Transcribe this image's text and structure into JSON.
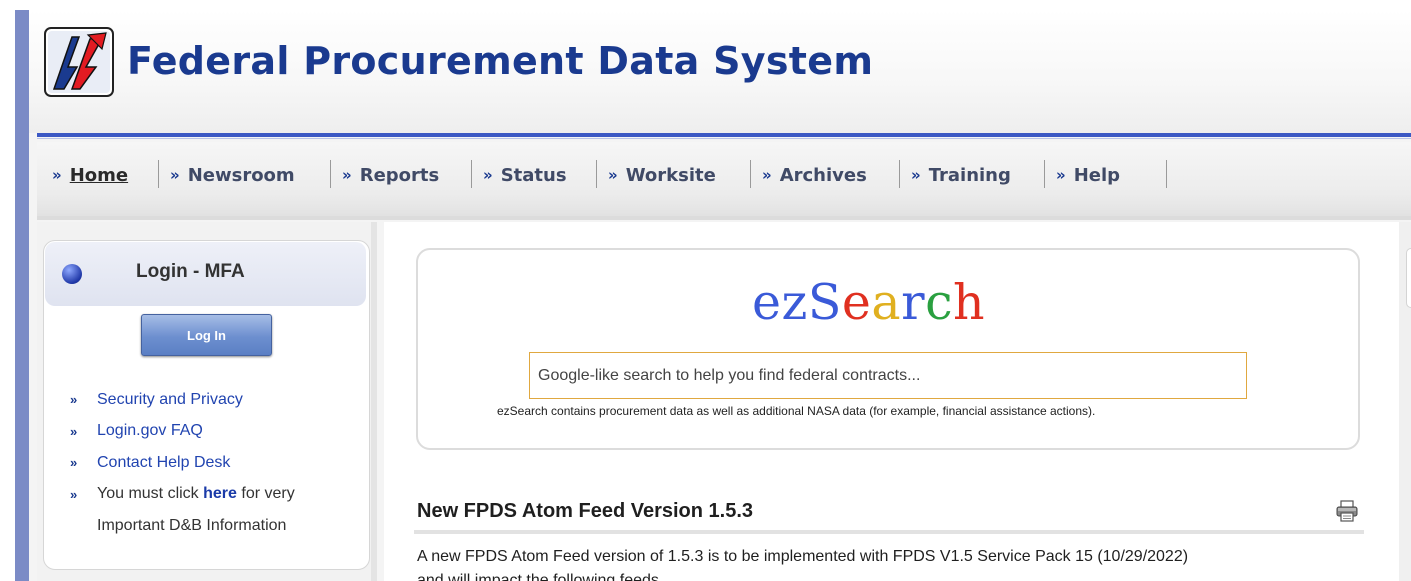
{
  "header": {
    "title": "Federal Procurement Data System",
    "logo_icon": "fpds-logo-icon"
  },
  "nav": {
    "items": [
      {
        "label": "Home",
        "active": true
      },
      {
        "label": "Newsroom"
      },
      {
        "label": "Reports"
      },
      {
        "label": "Status"
      },
      {
        "label": "Worksite"
      },
      {
        "label": "Archives"
      },
      {
        "label": "Training"
      },
      {
        "label": "Help"
      }
    ],
    "chevron": "»"
  },
  "login": {
    "title": "Login - MFA",
    "button_label": "Log In",
    "links": [
      {
        "label": "Security and Privacy"
      },
      {
        "label": "Login.gov FAQ"
      },
      {
        "label": "Contact Help Desk"
      }
    ],
    "notice_prefix": "You must click ",
    "notice_link": "here",
    "notice_suffix": " for very",
    "notice_line2": "Important D&B Information"
  },
  "ezsearch": {
    "logo_text": "ezSearch",
    "logo_letters": [
      "e",
      "z",
      "S",
      "e",
      "a",
      "r",
      "c",
      "h"
    ],
    "logo_colors": [
      "#3a5ad8",
      "#3a5ad8",
      "#3a5ad8",
      "#e03020",
      "#e0b020",
      "#3a5ad8",
      "#2aa040",
      "#e03020"
    ],
    "placeholder": "Google-like search to help you find federal contracts...",
    "note": "ezSearch contains procurement data as well as additional NASA data (for example, financial assistance actions)."
  },
  "news": {
    "title": "New FPDS Atom Feed Version 1.5.3",
    "print_icon": "printer-icon",
    "body_line1": "A new FPDS Atom Feed version of 1.5.3 is to be implemented with FPDS V1.5 Service Pack 15 (10/29/2022)",
    "body_line2": "and will impact the following feeds"
  },
  "colors": {
    "brand_blue": "#1a3a8f",
    "rule_blue": "#3b58c4",
    "stripe": "#7b8bc6"
  }
}
